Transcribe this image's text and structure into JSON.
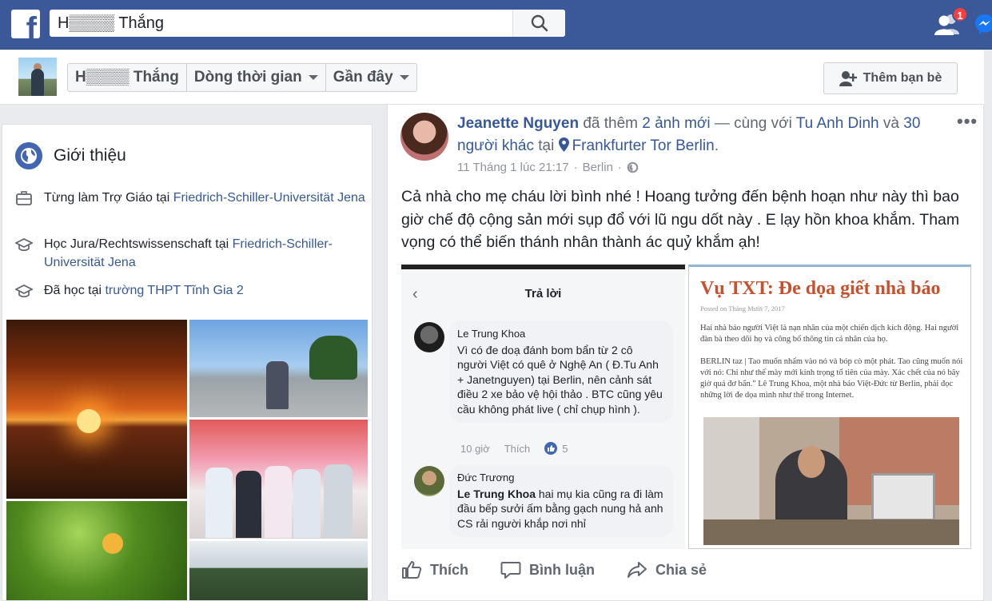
{
  "topbar": {
    "logo_letter": "f",
    "search_value": "H▒▒▒▒ Thắng",
    "friend_requests_count": "1"
  },
  "timeline_nav": {
    "profile_name": "H▒▒▒▒ Thắng",
    "timeline_label": "Dòng thời gian",
    "recent_label": "Gần đây",
    "add_friend_label": "Thêm bạn bè"
  },
  "intro": {
    "title": "Giới thiệu",
    "items": [
      {
        "icon": "briefcase-icon",
        "prefix": "Từng làm Trợ Giáo tại ",
        "link": "Friedrich-Schiller-Universität Jena"
      },
      {
        "icon": "graduation-cap-icon",
        "prefix": "Học Jura/Rechtswissenschaft tại ",
        "link": "Friedrich-Schiller-Universität Jena"
      },
      {
        "icon": "graduation-cap-icon",
        "prefix": "Đã học tại ",
        "link": "trường THPT Tĩnh Gia 2"
      }
    ]
  },
  "post": {
    "author": "Jeanette Nguyen",
    "added": " đã thêm ",
    "photos_count": "2 ảnh mới",
    "with": " — cùng với ",
    "tagged": "Tu Anh Dinh",
    "and": " và ",
    "others": "30 người khác",
    "at": " tại ",
    "place": "Frankfurter Tor Berlin",
    "place_suffix": ".",
    "timestamp": "11 Tháng 1 lúc 21:17",
    "location": "Berlin",
    "body": "Cả nhà cho mẹ cháu lời bình nhé ! Hoang tưởng đến bệnh hoạn như này thì bao giờ chế độ cộng sản mới sụp đổ với lũ ngu dốt này . E lạy hồn khoa khắm. Tham vọng có thể biến thánh nhân thành ác quỷ khắm ạh!",
    "more": "•••"
  },
  "screenshot_left": {
    "header": "Trả lời",
    "comments": [
      {
        "author": "Le Trung Khoa",
        "text": "Vì có đe doạ đánh bom bẩn từ 2 cô người Việt có quê ở Nghệ An ( Đ.Tu Anh + Janetnguyen) tại Berlin, nên cảnh sát điều 2 xe bảo vệ hội thảo . BTC cũng yêu cầu không phát live ( chỉ chụp hình ).",
        "time": "10 giờ",
        "like": "Thích",
        "reactions": "5"
      },
      {
        "author": "Đức Trương",
        "mention": "Le Trung Khoa",
        "text": " hai mụ kia cũng ra đi làm đầu bếp sưởi ấm bằng gạch nung hả anh CS rải người khắp nơi nhỉ"
      }
    ]
  },
  "screenshot_right": {
    "title": "Vụ TXT: Đe dọa giết nhà báo",
    "posted": "Posted on Tháng Mười 7, 2017",
    "para1": "Hai nhà báo người Việt là nạn nhân của một chiến dịch kích động. Hai người đàn bà theo dõi họ và công bố thông tin cá nhân của họ.",
    "para2": "BERLIN taz | Tao muốn nhấm vào nó và bóp cò một phát. Tao cũng muốn nói với nó: Chỉ như thế mày mới kính trọng tổ tiên của mày. Xác chết của nó bây giờ quá đơ bẩn.\" Lê Trung Khoa, một nhà báo Việt-Đức từ Berlin, phải đọc những lời đe dọa mình như thế trong Internet."
  },
  "actions": {
    "like": "Thích",
    "comment": "Bình luận",
    "share": "Chia sẻ"
  }
}
